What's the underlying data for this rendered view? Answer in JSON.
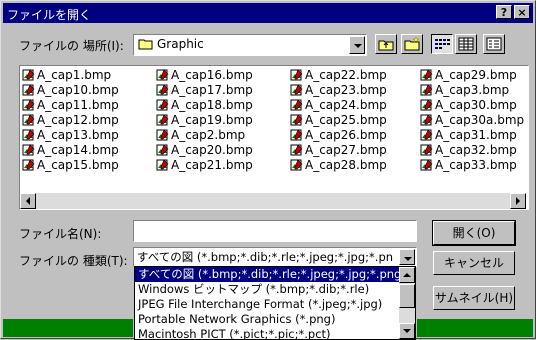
{
  "window": {
    "title": "ファイルを開く",
    "help_label": "?",
    "close_label": "×"
  },
  "lookin": {
    "label": "ファイルの 場所(I):",
    "value": "Graphic",
    "icon": "folder-icon"
  },
  "toolbar": {
    "icons": [
      "up-folder-icon",
      "new-folder-icon",
      "list-view-icon",
      "details-view-icon",
      "properties-icon"
    ]
  },
  "files": {
    "columns": [
      [
        "A_cap1.bmp",
        "A_cap10.bmp",
        "A_cap11.bmp",
        "A_cap12.bmp",
        "A_cap13.bmp",
        "A_cap14.bmp",
        "A_cap15.bmp"
      ],
      [
        "A_cap16.bmp",
        "A_cap17.bmp",
        "A_cap18.bmp",
        "A_cap19.bmp",
        "A_cap2.bmp",
        "A_cap20.bmp",
        "A_cap21.bmp"
      ],
      [
        "A_cap22.bmp",
        "A_cap23.bmp",
        "A_cap24.bmp",
        "A_cap25.bmp",
        "A_cap26.bmp",
        "A_cap27.bmp",
        "A_cap28.bmp"
      ],
      [
        "A_cap29.bmp",
        "A_cap3.bmp",
        "A_cap30.bmp",
        "A_cap30a.bmp",
        "A_cap31.bmp",
        "A_cap32.bmp",
        "A_cap33.bmp"
      ]
    ]
  },
  "filename": {
    "label": "ファイル名(N):",
    "value": ""
  },
  "filetype": {
    "label": "ファイルの 種類(T):",
    "value": "すべての図 (*.bmp;*.dib;*.rle;*.jpeg;*.jpg;*.pn",
    "options": [
      "すべての図 (*.bmp;*.dib;*.rle;*.jpeg;*.jpg;*.png",
      "Windows ビットマップ (*.bmp;*.dib;*.rle)",
      "JPEG File Interchange Format (*.jpeg;*.jpg)",
      "Portable Network Graphics (*.png)",
      "Macintosh PICT (*.pict;*.pic;*.pct)"
    ]
  },
  "buttons": {
    "open": "開く(O)",
    "cancel": "キャンセル",
    "thumbnail": "サムネイル(H)"
  },
  "colors": {
    "titlebar": "#000080",
    "selection": "#000080",
    "taskbar": "#008000"
  }
}
